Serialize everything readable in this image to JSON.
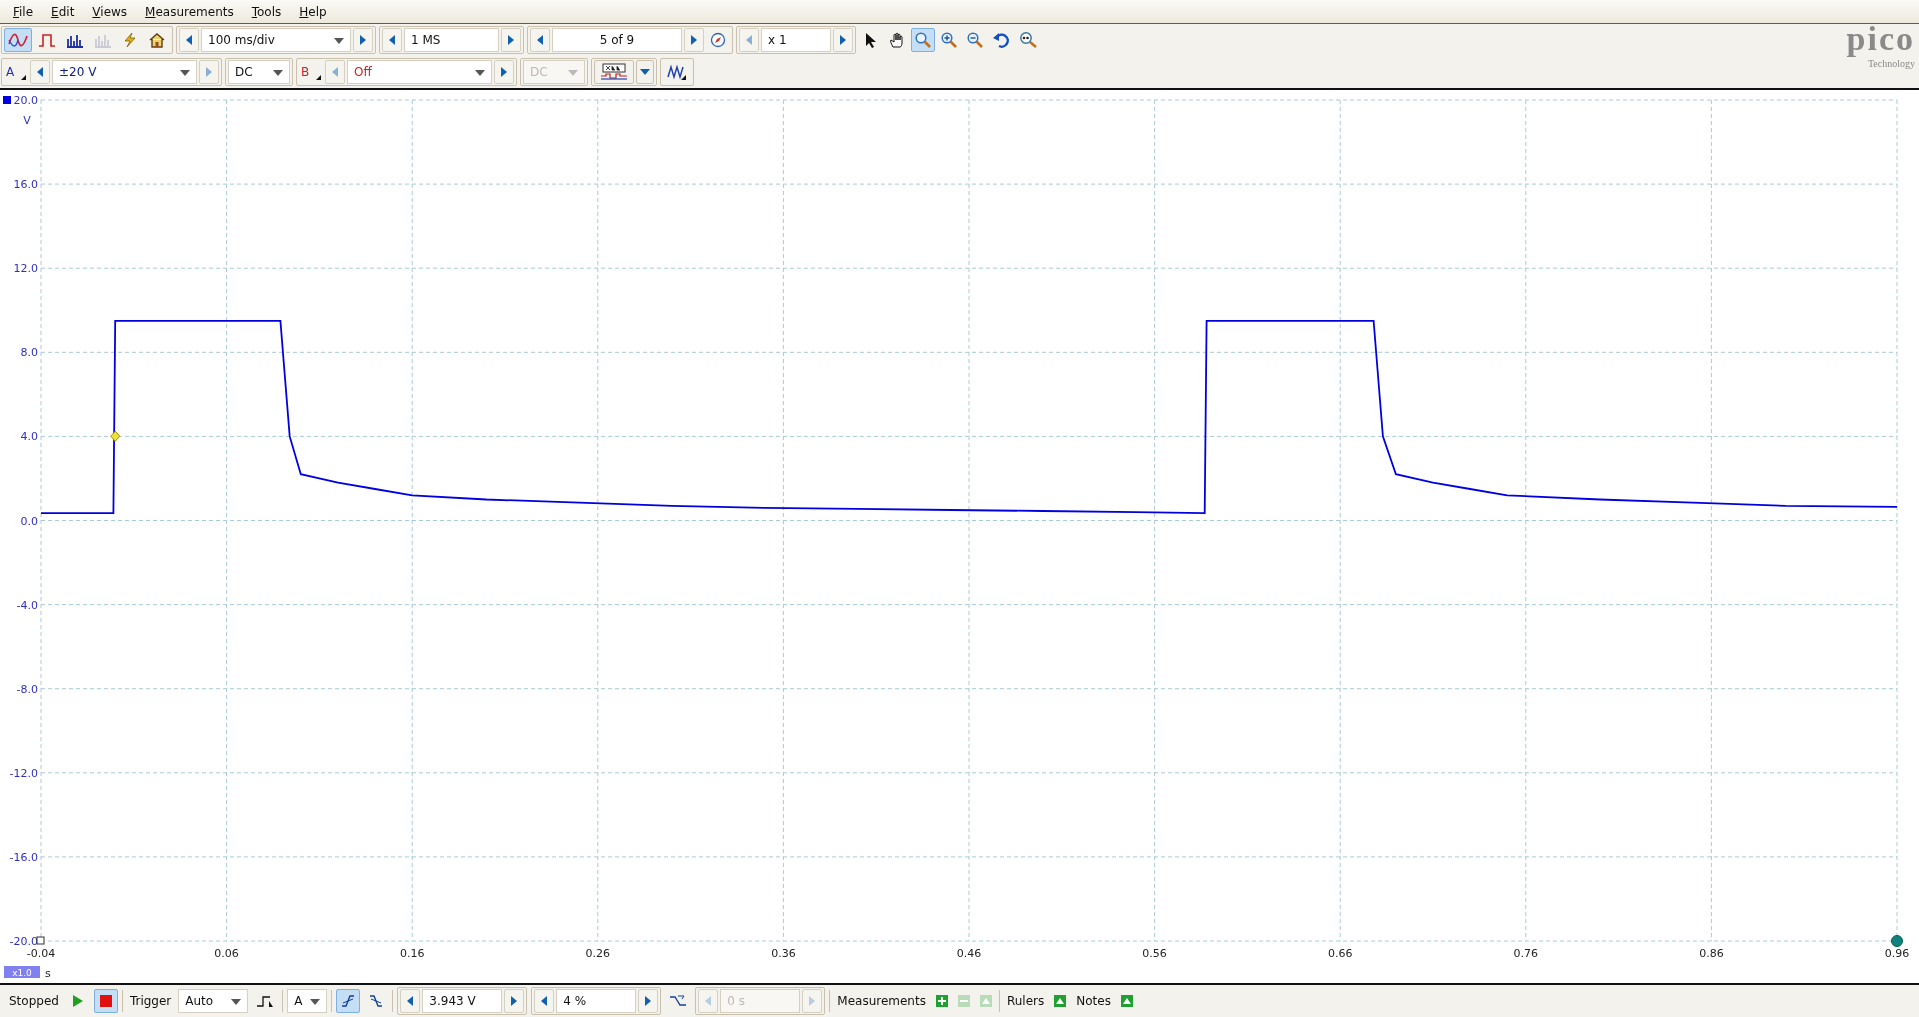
{
  "menu": [
    {
      "label": "File"
    },
    {
      "label": "Edit"
    },
    {
      "label": "Views"
    },
    {
      "label": "Measurements"
    },
    {
      "label": "Tools"
    },
    {
      "label": "Help"
    }
  ],
  "toolbar": {
    "view_buttons": [
      {
        "kind": "scope",
        "selected": true,
        "disabled": false
      },
      {
        "kind": "persistence",
        "selected": false,
        "disabled": false
      },
      {
        "kind": "spectrum",
        "selected": false,
        "disabled": false
      },
      {
        "kind": "spectrum",
        "selected": false,
        "disabled": true
      }
    ],
    "timebase": "100 ms/div",
    "samples": "1 MS",
    "buffer": "5 of 9",
    "zoom": "x 1",
    "tools": [
      {
        "kind": "pointer",
        "selected": false
      },
      {
        "kind": "hand",
        "selected": false
      },
      {
        "kind": "zoom-box",
        "selected": true
      },
      {
        "kind": "zoom-in",
        "selected": false
      },
      {
        "kind": "zoom-out",
        "selected": false
      },
      {
        "kind": "undo",
        "selected": false
      },
      {
        "kind": "zoom-fit",
        "selected": false
      }
    ]
  },
  "channels": [
    {
      "label": "A",
      "color": "#2030c0",
      "range": "±20 V",
      "coupling": "DC",
      "enabled": true
    },
    {
      "label": "B",
      "color": "#d02020",
      "range": "Off",
      "coupling": "DC",
      "enabled": false
    }
  ],
  "logo": {
    "name": "pico",
    "tagline": "Technology"
  },
  "chart_data": {
    "type": "line",
    "xlabel": "s",
    "ylabel": "V",
    "x": [
      -0.04,
      -0.001,
      0.0,
      0.089,
      0.094,
      0.1,
      0.12,
      0.14,
      0.16,
      0.2,
      0.25,
      0.3,
      0.35,
      0.4,
      0.45,
      0.5,
      0.55,
      0.587,
      0.588,
      0.678,
      0.683,
      0.69,
      0.71,
      0.73,
      0.75,
      0.8,
      0.85,
      0.9,
      0.96
    ],
    "series": [
      {
        "color": "#0000e0",
        "values": [
          0.35,
          0.35,
          9.5,
          9.5,
          4.0,
          2.2,
          1.8,
          1.5,
          1.2,
          1.0,
          0.85,
          0.7,
          0.6,
          0.55,
          0.5,
          0.45,
          0.4,
          0.35,
          9.5,
          9.5,
          4.0,
          2.2,
          1.8,
          1.5,
          1.2,
          1.0,
          0.85,
          0.7,
          0.65
        ]
      }
    ],
    "xlim": [
      -0.04,
      0.96
    ],
    "ylim": [
      -20,
      20
    ],
    "xticks": [
      -0.04,
      0.06,
      0.16,
      0.26,
      0.36,
      0.46,
      0.56,
      0.66,
      0.76,
      0.86,
      0.96
    ],
    "yticks": [
      {
        "value": 20,
        "label": "20.0"
      },
      {
        "value": 16,
        "label": "16.0"
      },
      {
        "value": 12,
        "label": "12.0"
      },
      {
        "value": 8,
        "label": "8.0"
      },
      {
        "value": 4,
        "label": "4.0"
      },
      {
        "value": 0,
        "label": "0.0"
      },
      {
        "value": -4,
        "label": "-4.0"
      },
      {
        "value": -8,
        "label": "-8.0"
      },
      {
        "value": -12,
        "label": "-12.0"
      },
      {
        "value": -16,
        "label": "-16.0"
      },
      {
        "value": -20,
        "label": "-20.0"
      }
    ],
    "grid": true
  },
  "zoom_badge": "x1.0",
  "status": {
    "run_state": "Stopped",
    "running": false,
    "trigger_label": "Trigger",
    "trigger_mode": "Auto",
    "trigger_source": "A",
    "edge_buttons": [
      {
        "kind": "rising",
        "selected": true
      },
      {
        "kind": "falling",
        "selected": false
      }
    ],
    "threshold": "3.943 V",
    "pre_trigger": "4 %",
    "delay": "0 s",
    "measurements_label": "Measurements",
    "rulers_label": "Rulers",
    "notes_label": "Notes"
  }
}
